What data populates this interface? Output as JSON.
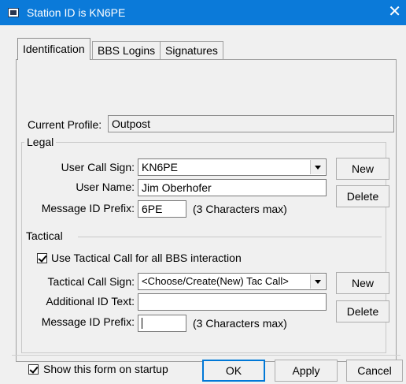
{
  "window": {
    "title": "Station ID is KN6PE",
    "close_label": "✕"
  },
  "tabs": [
    {
      "label": "Identification",
      "active": true
    },
    {
      "label": "BBS Logins",
      "active": false
    },
    {
      "label": "Signatures",
      "active": false
    }
  ],
  "current_profile": {
    "label": "Current Profile:",
    "value": "Outpost"
  },
  "legal": {
    "title": "Legal",
    "call_sign_label": "User Call Sign:",
    "call_sign_value": "KN6PE",
    "user_name_label": "User Name:",
    "user_name_value": "Jim Oberhofer",
    "msg_prefix_label": "Message ID Prefix:",
    "msg_prefix_value": "6PE",
    "msg_prefix_hint": "(3 Characters max)",
    "new_label": "New",
    "delete_label": "Delete"
  },
  "tactical": {
    "title": "Tactical",
    "use_tactical_label": "Use Tactical Call for all BBS interaction",
    "use_tactical_checked": true,
    "tac_call_label": "Tactical Call Sign:",
    "tac_call_value": "<Choose/Create(New) Tac Call>",
    "additional_id_label": "Additional ID Text:",
    "additional_id_value": "",
    "msg_prefix_label": "Message ID Prefix:",
    "msg_prefix_value": "",
    "msg_prefix_hint": "(3 Characters max)",
    "new_label": "New",
    "delete_label": "Delete"
  },
  "footer": {
    "show_on_startup_label": "Show this form on startup",
    "show_on_startup_checked": true,
    "ok_label": "OK",
    "apply_label": "Apply",
    "cancel_label": "Cancel"
  },
  "icons": {
    "app": "app-window-icon",
    "close": "close-icon",
    "dropdown": "chevron-down-icon"
  }
}
